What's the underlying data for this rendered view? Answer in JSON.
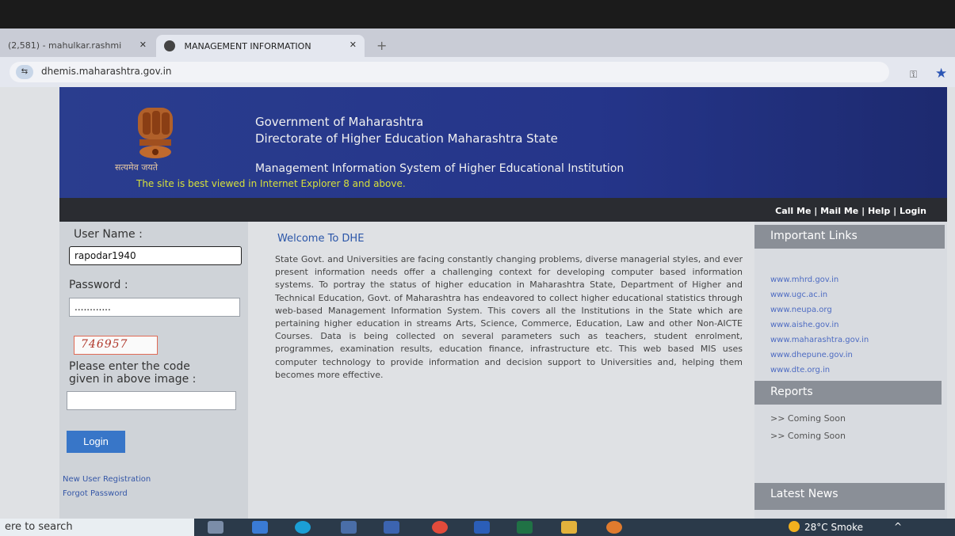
{
  "browser": {
    "tabs": [
      {
        "label": "(2,581) - mahulkar.rashmi"
      },
      {
        "label": "MANAGEMENT INFORMATION"
      }
    ],
    "new_tab": "+",
    "url": "dhemis.maharashtra.gov.in"
  },
  "header": {
    "motto": "सत्यमेव जयते",
    "line1": "Government of Maharashtra",
    "line2": "Directorate of Higher Education Maharashtra State",
    "system": "Management Information System of Higher Educational Institution",
    "best_viewed": "The site is best viewed in Internet Explorer 8 and above."
  },
  "toplinks": {
    "call": "Call Me",
    "mail": "Mail Me",
    "help": "Help",
    "login": "Login",
    "sep": " | "
  },
  "login": {
    "username_label": "User Name :",
    "username_value": "rapodar1940",
    "password_label": "Password :",
    "password_value": "............",
    "captcha": "746957",
    "code_prompt_1": "Please enter the code",
    "code_prompt_2": "given in above image :",
    "code_value": "",
    "button": "Login",
    "new_user": "New User Registration",
    "forgot": "Forgot Password"
  },
  "main": {
    "heading": "Welcome To DHE",
    "text": "State Govt. and Universities are facing constantly changing problems, diverse managerial styles, and ever present information needs offer a challenging context for developing computer based information systems. To portray the status of higher education in Maharashtra State, Department of Higher and Technical Education, Govt. of Maharashtra has endeavored to collect higher educational statistics through web-based Management Information System. This covers all the Institutions in the State which are pertaining higher education in streams Arts, Science, Commerce, Education, Law and other Non-AICTE Courses. Data is being collected on several parameters such as teachers, student enrolment, programmes, examination results, education finance, infrastructure etc. This web based MIS uses computer technology to provide information and decision support to Universities and, helping them becomes more effective."
  },
  "sidebar": {
    "important_links_title": "Important Links",
    "links": [
      "www.mhrd.gov.in",
      "www.ugc.ac.in",
      "www.neupa.org",
      "www.aishe.gov.in",
      "www.maharashtra.gov.in",
      "www.dhepune.gov.in",
      "www.dte.org.in"
    ],
    "reports_title": "Reports",
    "reports": [
      ">>  Coming Soon",
      ">>  Coming Soon"
    ],
    "news_title": "Latest News"
  },
  "taskbar": {
    "search": "ere to search",
    "weather": "28°C  Smoke",
    "tray": "^"
  }
}
